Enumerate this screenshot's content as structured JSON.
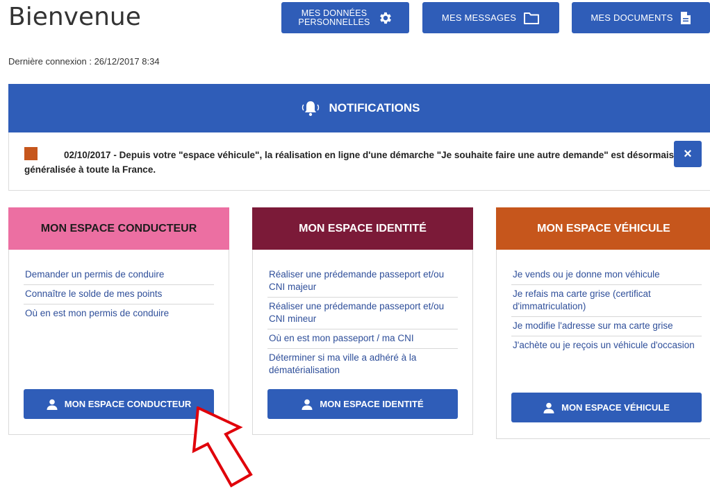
{
  "header": {
    "title": "Bienvenue",
    "buttons": {
      "donnees": "MES DONNÉES PERSONNELLES",
      "messages": "MES MESSAGES",
      "documents": "MES DOCUMENTS"
    },
    "last_login": "Dernière connexion : 26/12/2017 8:34"
  },
  "notifications": {
    "title": "NOTIFICATIONS",
    "message": "02/10/2017 - Depuis votre \"espace véhicule\", la réalisation en ligne d'une démarche \"Je souhaite faire une autre demande\" est désormais généralisée à toute la France.",
    "close": "×",
    "marker_color": "#c6561c"
  },
  "cards": {
    "conducteur": {
      "title": "MON ESPACE CONDUCTEUR",
      "color": "#ec6fa2",
      "links": [
        "Demander un permis de conduire",
        "Connaître le solde de mes points",
        "Où en est mon permis de conduire"
      ],
      "button": "MON ESPACE CONDUCTEUR"
    },
    "identite": {
      "title": "MON ESPACE IDENTITÉ",
      "color": "#7b1a38",
      "links": [
        "Réaliser une prédemande passeport et/ou CNI majeur",
        "Réaliser une prédemande passeport et/ou CNI mineur",
        "Où en est mon passeport / ma CNI",
        "Déterminer si ma ville a adhéré à la dématérialisation"
      ],
      "button": "MON ESPACE IDENTITÉ"
    },
    "vehicule": {
      "title": "MON ESPACE VÉHICULE",
      "color": "#c6561c",
      "links": [
        "Je vends ou je donne mon véhicule",
        "Je refais ma carte grise (certificat d'immatriculation)",
        "Je modifie l'adresse sur ma carte grise",
        "J'achète ou je reçois un véhicule d'occasion"
      ],
      "button": "MON ESPACE VÉHICULE"
    }
  },
  "theme": {
    "primary": "#2f5db8",
    "annotation_arrow": "#e0000a"
  },
  "icons": {
    "donnees": "gear-icon",
    "messages": "folder-icon",
    "documents": "document-icon",
    "notifications": "bell-icon",
    "buttons": "user-icon"
  }
}
